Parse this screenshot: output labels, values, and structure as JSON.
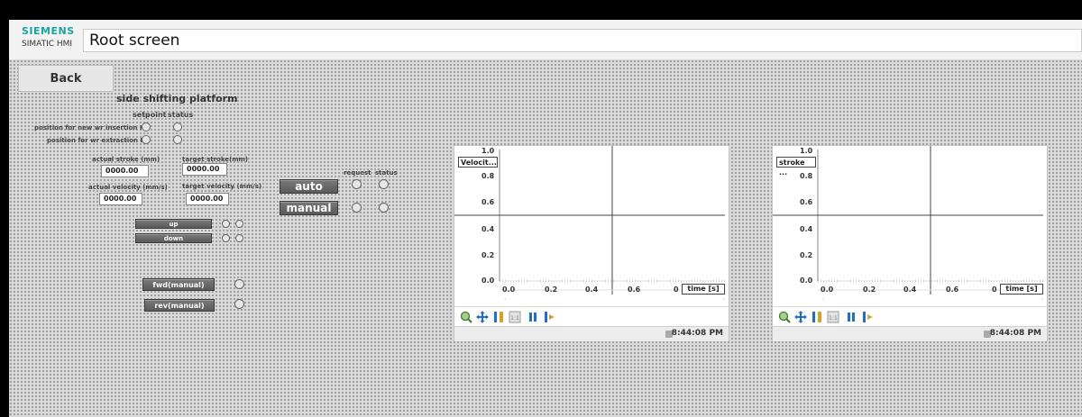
{
  "header": {
    "brand": "SIEMENS",
    "product": "SIMATIC HMI",
    "title": "Root screen"
  },
  "nav": {
    "back_label": "Back"
  },
  "section": {
    "title": "side shifting platform",
    "col_setpoint": "setpoint",
    "col_status": "status",
    "row1_label": "position for new wr insertion H1",
    "row2_label": "position for wr extraction H8"
  },
  "stroke": {
    "actual_label": "actual stroke (mm)",
    "actual_value": "0000.00",
    "target_label": "target stroke(mm)",
    "target_value": "0000.00"
  },
  "velocity": {
    "actual_label": "actual velocity (mm/s)",
    "actual_value": "0000.00",
    "target_label": "target velocity (mm/s)",
    "target_value": "0000.00"
  },
  "motion": {
    "up_label": "up",
    "down_label": "down",
    "fwd_label": "fwd(manual)",
    "rev_label": "rev(manual)"
  },
  "mode": {
    "col_request": "request",
    "col_status": "status",
    "auto_label": "auto",
    "manual_label": "manual"
  },
  "trends": [
    {
      "legend": "Velocit...",
      "y_ticks": [
        "1.0",
        "0.8",
        "0.6",
        "0.4",
        "0.2",
        "0.0"
      ],
      "x_ticks": [
        "0.0",
        "0.2",
        "0.4",
        "0.6",
        "0"
      ],
      "x_label": "time [s]",
      "time": "8:44:08 PM"
    },
    {
      "legend": "stroke ...",
      "y_ticks": [
        "1.0",
        "0.8",
        "0.6",
        "0.4",
        "0.2",
        "0.0"
      ],
      "x_ticks": [
        "0.0",
        "0.2",
        "0.4",
        "0.6",
        "0"
      ],
      "x_label": "time [s]",
      "time": "8:44:08 PM"
    }
  ],
  "toolbar_icons": [
    "zoom-icon",
    "move-icon",
    "ruler-vertical-icon",
    "zoom-100-icon",
    "pause-icon",
    "ruler-scroll-icon"
  ],
  "colors": {
    "brand": "#1aa3a3",
    "button_dark": "#5a5a5a",
    "canvas": "#d9d9d9"
  }
}
